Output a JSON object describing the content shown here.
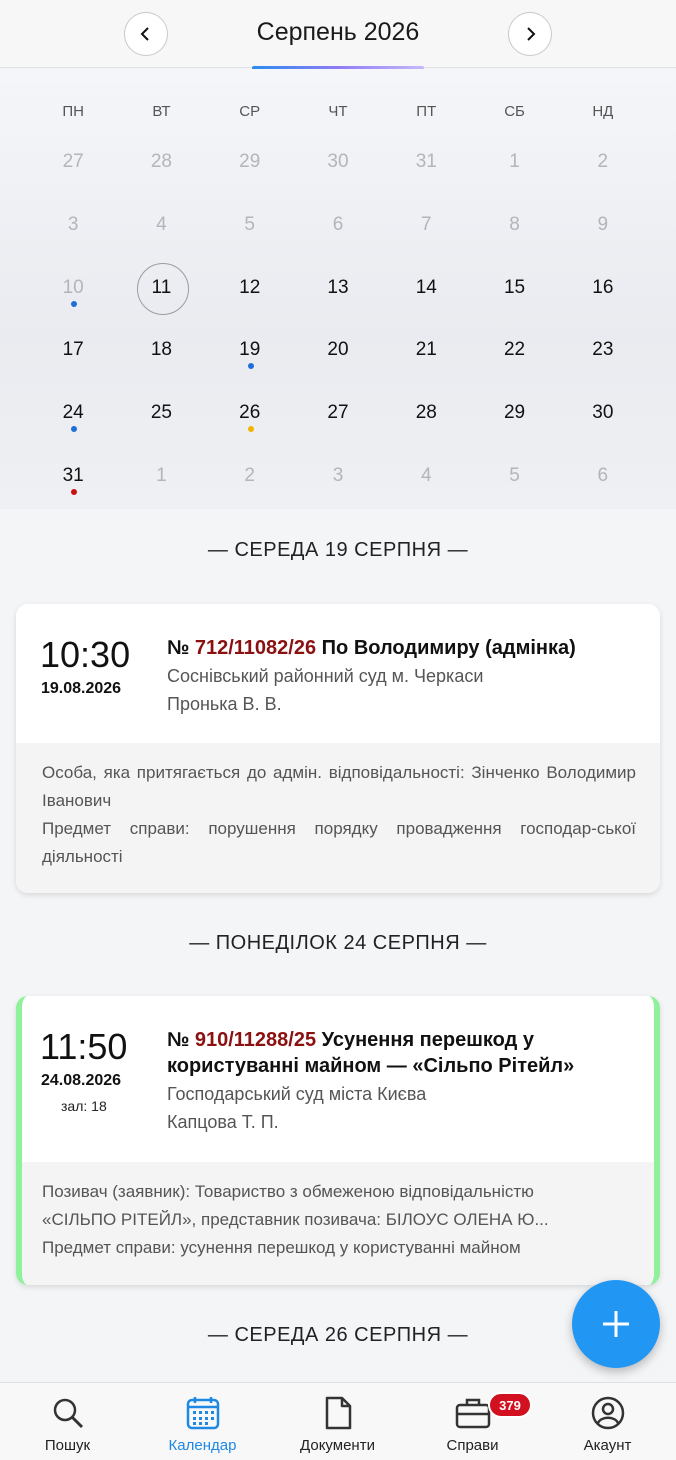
{
  "header": {
    "month_title": "Серпень 2026",
    "prev_icon": "chevron-left-icon",
    "next_icon": "chevron-right-icon"
  },
  "calendar": {
    "weekdays": [
      "ПН",
      "ВТ",
      "СР",
      "ЧТ",
      "ПТ",
      "СБ",
      "НД"
    ],
    "weeks": [
      [
        {
          "d": "27",
          "muted": true
        },
        {
          "d": "28",
          "muted": true
        },
        {
          "d": "29",
          "muted": true
        },
        {
          "d": "30",
          "muted": true
        },
        {
          "d": "31",
          "muted": true
        },
        {
          "d": "1",
          "muted": true
        },
        {
          "d": "2",
          "muted": true
        }
      ],
      [
        {
          "d": "3",
          "muted": true
        },
        {
          "d": "4",
          "muted": true
        },
        {
          "d": "5",
          "muted": true
        },
        {
          "d": "6",
          "muted": true
        },
        {
          "d": "7",
          "muted": true
        },
        {
          "d": "8",
          "muted": true
        },
        {
          "d": "9",
          "muted": true
        }
      ],
      [
        {
          "d": "10",
          "muted": true,
          "dot": "#1e6fd9"
        },
        {
          "d": "11",
          "today": true
        },
        {
          "d": "12"
        },
        {
          "d": "13"
        },
        {
          "d": "14"
        },
        {
          "d": "15"
        },
        {
          "d": "16"
        }
      ],
      [
        {
          "d": "17"
        },
        {
          "d": "18"
        },
        {
          "d": "19",
          "dot": "#1e6fd9"
        },
        {
          "d": "20"
        },
        {
          "d": "21"
        },
        {
          "d": "22"
        },
        {
          "d": "23"
        }
      ],
      [
        {
          "d": "24",
          "dot": "#1e6fd9"
        },
        {
          "d": "25"
        },
        {
          "d": "26",
          "dot": "#f2b400"
        },
        {
          "d": "27"
        },
        {
          "d": "28"
        },
        {
          "d": "29"
        },
        {
          "d": "30"
        }
      ],
      [
        {
          "d": "31",
          "dot": "#cc1010"
        },
        {
          "d": "1",
          "muted": true
        },
        {
          "d": "2",
          "muted": true
        },
        {
          "d": "3",
          "muted": true
        },
        {
          "d": "4",
          "muted": true
        },
        {
          "d": "5",
          "muted": true
        },
        {
          "d": "6",
          "muted": true
        }
      ]
    ]
  },
  "days": [
    {
      "heading": "— СЕРЕДА 19 СЕРПНЯ —",
      "event": {
        "time": "10:30",
        "date": "19.08.2026",
        "case_prefix": "№ ",
        "case_number": "712/11082/26",
        "case_title": " По Володимиру (адмінка)",
        "court": "Соснівський районний суд м. Черкаси",
        "judge": "Пронька В. В.",
        "details": [
          "Особа, яка притягається до адмін. відповідальності: Зінченко Володимир Іванович",
          "Предмет справи: порушення порядку провадження господар-ської діяльності"
        ]
      }
    },
    {
      "heading": "— ПОНЕДІЛОК 24 СЕРПНЯ —",
      "event": {
        "time": "11:50",
        "date": "24.08.2026",
        "hall": "зал: 18",
        "case_prefix": "№ ",
        "case_number": "910/11288/25",
        "case_title": " Усунення перешкод у користуванні майном — «Сільпо Рітейл»",
        "court": "Господарський суд міста Києва",
        "judge": "Капцова Т. П.",
        "details": [
          "Позивач (заявник): Товариство з обмеженою відповідальністю",
          "«СІЛЬПО РІТЕЙЛ», представник позивача: БІЛОУС ОЛЕНА Ю...",
          "Предмет справи: усунення перешкод у користуванні майном"
        ],
        "accent": "#8ff29b"
      }
    },
    {
      "heading": "— СЕРЕДА 26 СЕРПНЯ —"
    }
  ],
  "fab": {
    "icon": "plus-icon"
  },
  "bottom_nav": [
    {
      "label": "Пошук",
      "icon": "search-icon"
    },
    {
      "label": "Календар",
      "icon": "calendar-icon",
      "active": true
    },
    {
      "label": "Документи",
      "icon": "document-icon"
    },
    {
      "label": "Справи",
      "icon": "briefcase-icon",
      "badge": "379"
    },
    {
      "label": "Акаунт",
      "icon": "account-icon"
    }
  ],
  "colors": {
    "accent": "#1e88e5",
    "case_number": "#8b1010",
    "badge": "#d3101f",
    "fab": "#2196f3"
  }
}
